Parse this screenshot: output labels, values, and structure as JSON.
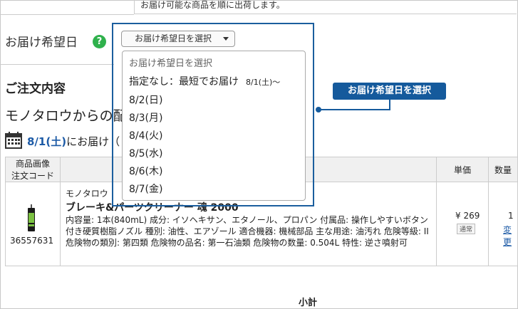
{
  "top_note": "お届け可能な商品を順に出荷します。",
  "delivery": {
    "label": "お届け希望日",
    "help_icon": "question-icon",
    "select_value": "お届け希望日を選択"
  },
  "dropdown": {
    "options": [
      {
        "label": "お届け希望日を選択",
        "sub": ""
      },
      {
        "label": "指定なし：最短でお届け",
        "sub": "8/1(土)〜"
      },
      {
        "label": "8/2(日)",
        "sub": ""
      },
      {
        "label": "8/3(月)",
        "sub": ""
      },
      {
        "label": "8/4(火)",
        "sub": ""
      },
      {
        "label": "8/5(水)",
        "sub": ""
      },
      {
        "label": "8/6(木)",
        "sub": ""
      },
      {
        "label": "8/7(金)",
        "sub": ""
      }
    ]
  },
  "callout": "お届け希望日を選択",
  "order": {
    "section_title": "ご注文内容",
    "vendor_title": "モノタロウからの配",
    "deliver_date": "8/1(土)",
    "deliver_suffix": "にお届け（",
    "columns": {
      "image_code": [
        "商品画像",
        "注文コード"
      ],
      "unit_price": "単価",
      "quantity": "数量"
    },
    "item": {
      "code": "36557631",
      "maker": "モノタロウ",
      "name": "ブレーキ&パーツクリーナー 魂 2000",
      "description": "内容量: 1本(840mL)  成分: イソヘキサン、エタノール、プロパン  付属品: 操作しやすいボタン付き硬質樹脂ノズル  種別: 油性、エアゾール  適合機器: 機械部品  主な用途: 油汚れ  危険等級: II  危険物の類別: 第四類  危険物の品名: 第一石油類  危険物の数量: 0.504L  特性: 逆さ噴射可",
      "price": "¥ 269",
      "price_badge": "通常",
      "quantity": "1",
      "change_link": "変更"
    },
    "subtotal_label": "小計"
  },
  "colors": {
    "accent": "#155a9c",
    "help": "#2fb14c",
    "link": "#1c5aa6"
  }
}
